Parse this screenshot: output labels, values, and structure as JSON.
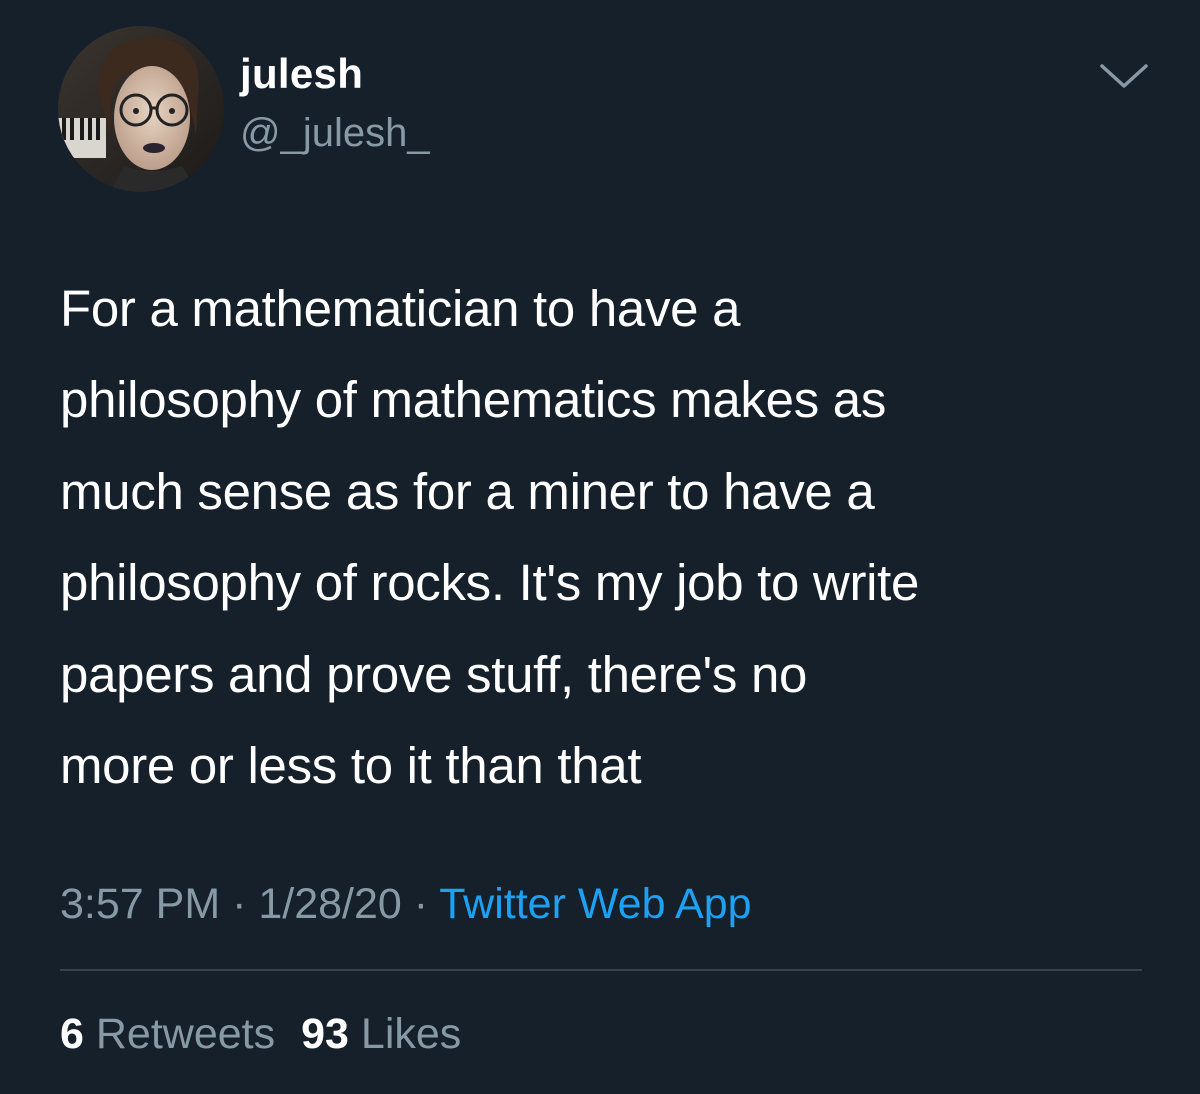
{
  "colors": {
    "background": "#15202b",
    "text_primary": "#ffffff",
    "text_secondary": "#8899a6",
    "link": "#1da1f2",
    "divider": "#38444d"
  },
  "author": {
    "display_name": "julesh",
    "handle": "@_julesh_",
    "avatar_icon": "profile-photo"
  },
  "menu": {
    "icon": "chevron-down-icon"
  },
  "tweet": {
    "text": "For a mathematician to have a\nphilosophy of mathematics makes as\nmuch sense as for a miner to have a\nphilosophy of rocks. It's my job to write\npapers and prove stuff, there's no\nmore or less to it than that"
  },
  "meta": {
    "time": "3:57 PM",
    "separator": " · ",
    "date": "1/28/20",
    "source": "Twitter Web App"
  },
  "stats": {
    "retweets_count": "6",
    "retweets_label": "Retweets",
    "likes_count": "93",
    "likes_label": "Likes"
  }
}
